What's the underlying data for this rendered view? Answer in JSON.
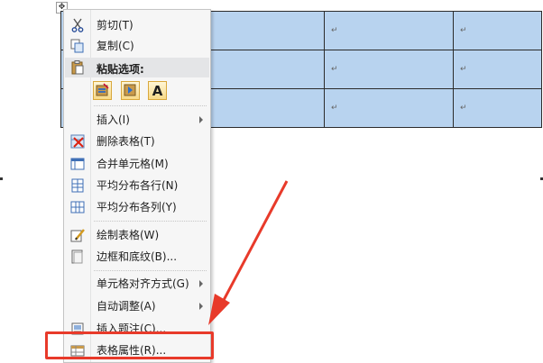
{
  "table": {
    "cell_mark": "↵",
    "rows": 3,
    "cols": 3
  },
  "menu": {
    "items": [
      {
        "label": "剪切(T)",
        "icon": "scissors-icon"
      },
      {
        "label": "复制(C)",
        "icon": "copy-icon"
      },
      {
        "label": "粘贴选项:",
        "icon": "clipboard-icon"
      },
      {
        "label": "插入(I)",
        "has_submenu": true
      },
      {
        "label": "删除表格(T)",
        "icon": "delete-table-icon"
      },
      {
        "label": "合并单元格(M)",
        "icon": "merge-cells-icon"
      },
      {
        "label": "平均分布各行(N)",
        "icon": "distribute-rows-icon"
      },
      {
        "label": "平均分布各列(Y)",
        "icon": "distribute-columns-icon"
      },
      {
        "label": "绘制表格(W)",
        "icon": "draw-table-icon"
      },
      {
        "label": "边框和底纹(B)...",
        "icon": "borders-icon"
      },
      {
        "label": "单元格对齐方式(G)",
        "has_submenu": true
      },
      {
        "label": "自动调整(A)",
        "has_submenu": true
      },
      {
        "label": "插入题注(C)...",
        "icon": "caption-icon"
      },
      {
        "label": "表格属性(R)...",
        "icon": "table-properties-icon"
      }
    ],
    "paste_options": [
      {
        "name": "keep-source-formatting",
        "glyph": ""
      },
      {
        "name": "merge-formatting",
        "glyph": ""
      },
      {
        "name": "keep-text-only",
        "glyph": "A"
      }
    ]
  },
  "annotation": {
    "color": "#e83a2a"
  }
}
